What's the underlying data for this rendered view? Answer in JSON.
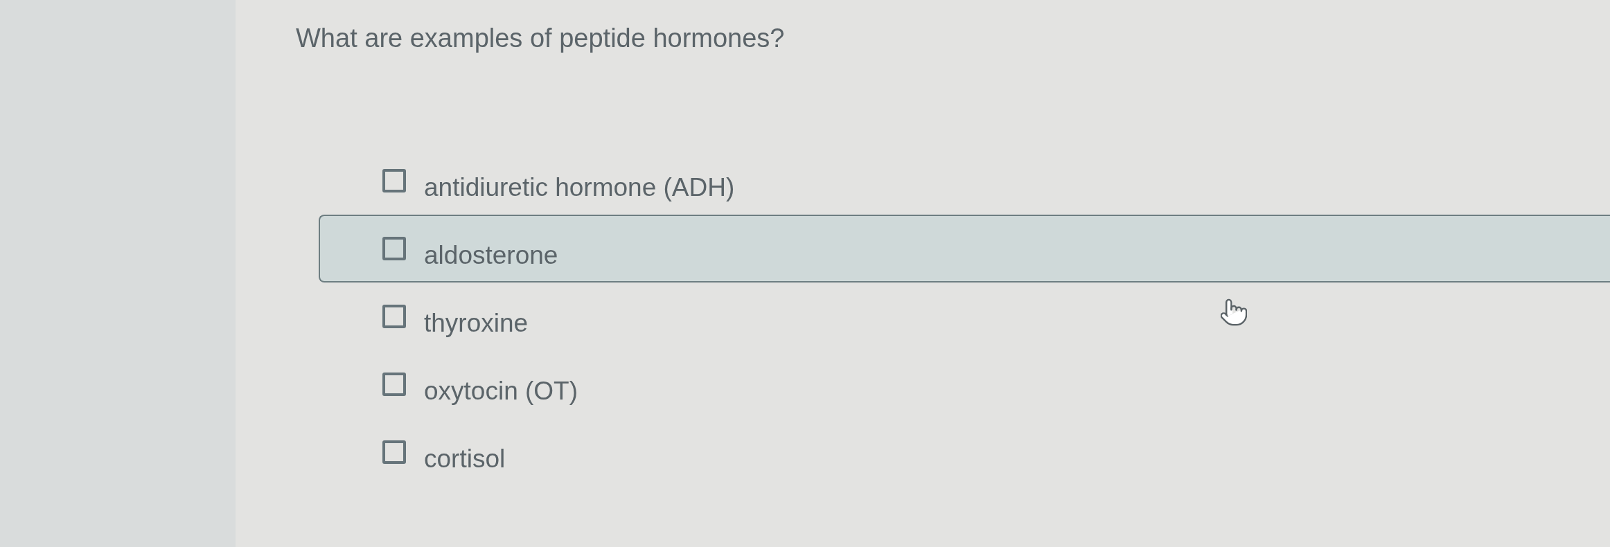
{
  "question": "What are examples of peptide hormones?",
  "options": [
    {
      "label": "antidiuretic hormone (ADH)",
      "checked": false,
      "hovered": false
    },
    {
      "label": "aldosterone",
      "checked": false,
      "hovered": true
    },
    {
      "label": "thyroxine",
      "checked": false,
      "hovered": false
    },
    {
      "label": "oxytocin (OT)",
      "checked": false,
      "hovered": false
    },
    {
      "label": "cortisol",
      "checked": false,
      "hovered": false
    }
  ]
}
